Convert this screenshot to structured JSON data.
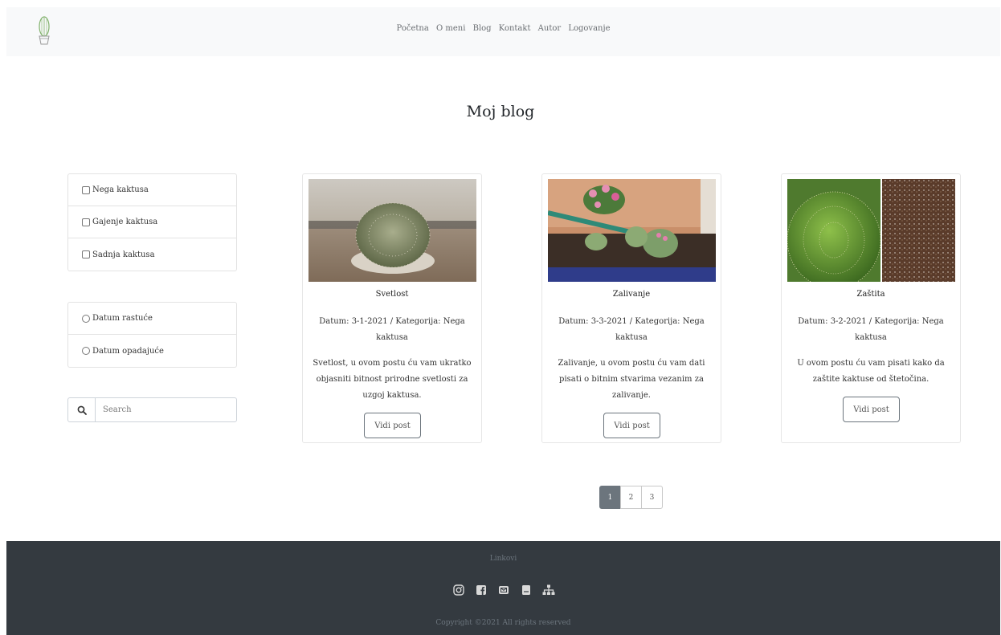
{
  "nav": {
    "items": [
      "Početna",
      "O meni",
      "Blog",
      "Kontakt",
      "Autor",
      "Logovanje"
    ]
  },
  "page_title": "Moj blog",
  "filters": {
    "categories": [
      "Nega kaktusa",
      "Gajenje kaktusa",
      "Sadnja kaktusa"
    ],
    "sort": [
      "Datum rastuće",
      "Datum opadajuće"
    ]
  },
  "search": {
    "placeholder": "Search"
  },
  "posts": [
    {
      "title": "Svetlost",
      "meta": "Datum: 3-1-2021 / Kategorija: Nega kaktusa",
      "excerpt": "Svetlost, u ovom postu ću vam ukratko objasniti bitnost prirodne svetlosti za uzgoj kaktusa.",
      "button": "Vidi post"
    },
    {
      "title": "Zalivanje",
      "meta": "Datum: 3-3-2021 / Kategorija: Nega kaktusa",
      "excerpt": "Zalivanje, u ovom postu ću vam dati pisati o bitnim stvarima vezanim za zalivanje.",
      "button": "Vidi post"
    },
    {
      "title": "Zaštita",
      "meta": "Datum: 3-2-2021 / Kategorija: Nega kaktusa",
      "excerpt": "U ovom postu ću vam pisati kako da zaštite kaktuse od štetočina.",
      "button": "Vidi post"
    }
  ],
  "pagination": {
    "pages": [
      "1",
      "2",
      "3"
    ],
    "active": "1"
  },
  "footer": {
    "links_label": "Linkovi",
    "icons": [
      "instagram-icon",
      "facebook-icon",
      "email-icon",
      "document-icon",
      "sitemap-icon"
    ],
    "copyright": "Copyright ©2021 All rights reserved"
  },
  "colors": {
    "navbar_bg": "#f8f9fa",
    "footer_bg": "#343a40",
    "active_page": "#6c757d"
  }
}
